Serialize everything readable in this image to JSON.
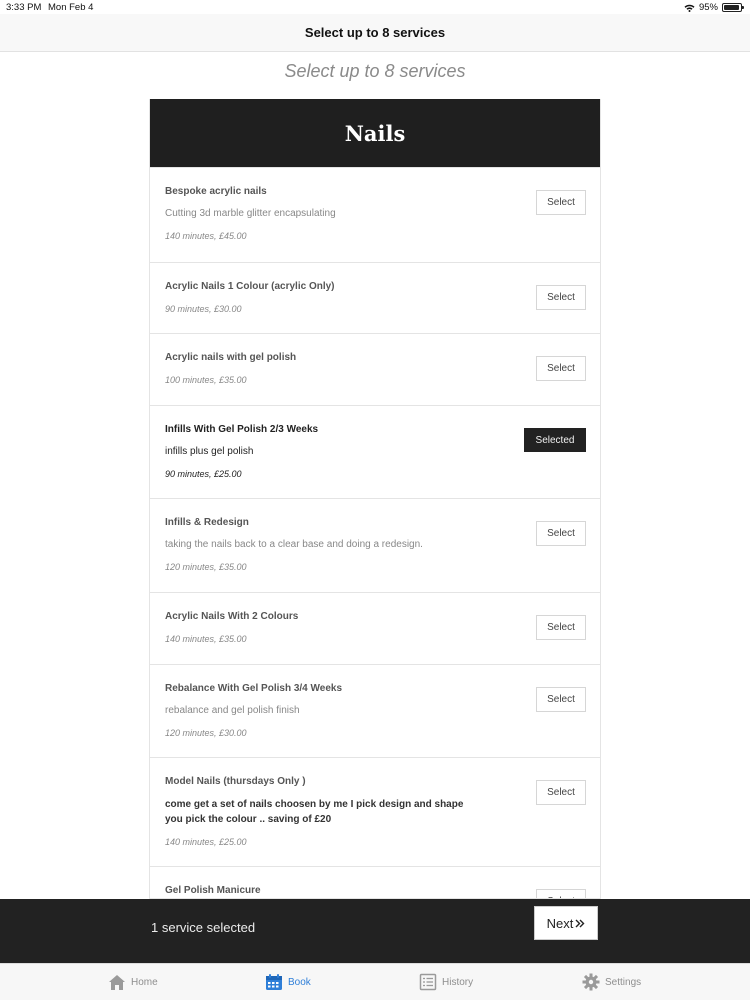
{
  "status_bar": {
    "time": "3:33 PM",
    "date": "Mon Feb 4",
    "battery": "95%"
  },
  "nav": {
    "title": "Select up to 8 services"
  },
  "subtitle": "Select up to 8 services",
  "category": {
    "title": "Nails"
  },
  "services": [
    {
      "name": "Bespoke acrylic nails",
      "description": "Cutting 3d marble glitter encapsulating",
      "meta": "140 minutes, £45.00",
      "button": "Select",
      "selected": false
    },
    {
      "name": "Acrylic Nails 1 Colour (acrylic Only)",
      "description": "",
      "meta": "90 minutes, £30.00",
      "button": "Select",
      "selected": false
    },
    {
      "name": "Acrylic nails with gel polish",
      "description": "",
      "meta": "100 minutes, £35.00",
      "button": "Select",
      "selected": false
    },
    {
      "name": "Infills With Gel Polish 2/3 Weeks",
      "description": "infills plus gel polish",
      "meta": "90 minutes, £25.00",
      "button": "Selected",
      "selected": true
    },
    {
      "name": "Infills & Redesign",
      "description": "taking the nails back to a clear base and doing a redesign.",
      "meta": "120 minutes, £35.00",
      "button": "Select",
      "selected": false
    },
    {
      "name": "Acrylic Nails With 2 Colours",
      "description": "",
      "meta": "140 minutes, £35.00",
      "button": "Select",
      "selected": false
    },
    {
      "name": "Rebalance With Gel Polish 3/4 Weeks",
      "description": "rebalance and gel polish finish",
      "meta": "120 minutes, £30.00",
      "button": "Select",
      "selected": false
    },
    {
      "name": "Model Nails (thursdays Only )",
      "description": "come get a set of nails choosen by me I pick design and shape you pick the colour .. saving of £20",
      "meta": "140 minutes, £25.00",
      "button": "Select",
      "selected": false
    },
    {
      "name": "Gel Polish Manicure",
      "description": "",
      "meta": "",
      "button": "Select",
      "selected": false
    }
  ],
  "footer": {
    "count_text": "1 service selected",
    "next_label": "Next",
    "next_icon": "double-chevron-right-icon"
  },
  "tabs": [
    {
      "label": "Home",
      "icon": "home-icon",
      "active": false
    },
    {
      "label": "Book",
      "icon": "calendar-icon",
      "active": true
    },
    {
      "label": "History",
      "icon": "list-icon",
      "active": false
    },
    {
      "label": "Settings",
      "icon": "gear-icon",
      "active": false
    }
  ],
  "colors": {
    "header_bg": "#1f1f1f",
    "footer_bg": "#222222",
    "active_tab": "#2f7fd8",
    "selected_button_bg": "#222222"
  }
}
